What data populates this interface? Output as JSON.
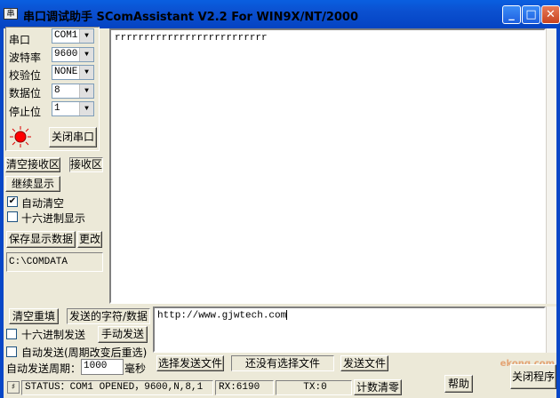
{
  "window": {
    "title": "串口调试助手  SComAssistant V2.2 For WIN9X/NT/2000",
    "minimize": "_",
    "maximize": "□",
    "close": "✕",
    "app_icon": "串"
  },
  "settings": {
    "port_label": "串口",
    "port_value": "COM1",
    "baud_label": "波特率",
    "baud_value": "9600",
    "parity_label": "校验位",
    "parity_value": "NONE",
    "databits_label": "数据位",
    "databits_value": "8",
    "stopbits_label": "停止位",
    "stopbits_value": "1",
    "close_port_button": "关闭串口"
  },
  "receive": {
    "clear_button": "清空接收区",
    "area_label": "接收区",
    "continue_button": "继续显示",
    "auto_clear_label": "自动清空",
    "auto_clear_checked": true,
    "hex_display_label": "十六进制显示",
    "hex_display_checked": false,
    "save_button": "保存显示数据",
    "change_button": "更改",
    "path": "C:\\COMDATA",
    "content": "rrrrrrrrrrrrrrrrrrrrrrrrrr"
  },
  "send": {
    "clear_button": "清空重填",
    "area_label": "发送的字符/数据",
    "hex_send_label": "十六进制发送",
    "manual_send_button": "手动发送",
    "auto_send_label": "自动发送(周期改变后重选)",
    "period_label": "自动发送周期：",
    "period_value": "1000",
    "period_unit": "毫秒",
    "select_file_button": "选择发送文件",
    "no_file_text": "还没有选择文件",
    "send_file_button": "发送文件",
    "content": "http://www.gjwtech.com"
  },
  "status": {
    "text": "STATUS：COM1 OPENED，9600,N,8,1",
    "rx": "RX:6190",
    "tx": "TX:0",
    "reset_count_button": "计数清零"
  },
  "footer": {
    "help_button": "帮助",
    "exit_button": "关闭程序",
    "watermark": "ekong.com"
  },
  "icons": {
    "status_led": "red-led",
    "accent": "#0a5fe0",
    "led_color": "#ff0000"
  }
}
